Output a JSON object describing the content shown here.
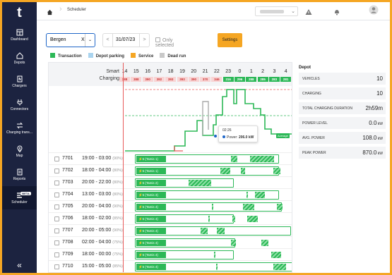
{
  "sidebar": {
    "logo": "t",
    "items": [
      {
        "label": "Dashboard",
        "icon": "dashboard-icon"
      },
      {
        "label": "Depots",
        "icon": "depot-icon"
      },
      {
        "label": "Chargers",
        "icon": "charger-icon"
      },
      {
        "label": "Connectors",
        "icon": "connector-icon"
      },
      {
        "label": "Charging trans...",
        "icon": "transactions-icon"
      },
      {
        "label": "Map",
        "icon": "map-pin-icon"
      },
      {
        "label": "Reports",
        "icon": "reports-icon"
      },
      {
        "label": "Scheduler",
        "icon": "scheduler-icon",
        "badge": "BETA",
        "active": true
      }
    ],
    "collapse_label": "«"
  },
  "topbar": {
    "breadcrumb": "Scheduler"
  },
  "controls": {
    "location_value": "Bergen",
    "clear_label": "X",
    "date": "31/07/23",
    "prev_label": "<",
    "next_label": ">",
    "only_selected_label": "Only selected",
    "settings_label": "Settings"
  },
  "legend": [
    {
      "label": "Transaction",
      "color": "#2cb857"
    },
    {
      "label": "Depot parking",
      "color": "#aad4ef"
    },
    {
      "label": "Service",
      "color": "#f5a623"
    },
    {
      "label": "Dead run",
      "color": "#c9c9c9"
    }
  ],
  "header": {
    "smart_charging_label": "Smart\nCharging",
    "hours": [
      {
        "h": "14",
        "c": "388",
        "tone": "red"
      },
      {
        "h": "15",
        "c": "388",
        "tone": "red"
      },
      {
        "h": "16",
        "c": "390",
        "tone": "red"
      },
      {
        "h": "17",
        "c": "392",
        "tone": "red"
      },
      {
        "h": "18",
        "c": "393",
        "tone": "red"
      },
      {
        "h": "19",
        "c": "393",
        "tone": "red"
      },
      {
        "h": "20",
        "c": "390",
        "tone": "red"
      },
      {
        "h": "21",
        "c": "370",
        "tone": "red"
      },
      {
        "h": "22",
        "c": "346",
        "tone": "red"
      },
      {
        "h": "23",
        "c": "316",
        "tone": "green"
      },
      {
        "h": "0",
        "c": "296",
        "tone": "green"
      },
      {
        "h": "1",
        "c": "288",
        "tone": "green"
      },
      {
        "h": "2",
        "c": "285",
        "tone": "green"
      },
      {
        "h": "3",
        "c": "283",
        "tone": "green"
      },
      {
        "h": "4",
        "c": "281",
        "tone": "green"
      }
    ]
  },
  "chart": {
    "tooltip_time": "02:26",
    "tooltip_label": "Power:",
    "tooltip_value": "206.0 kW",
    "average_label": "Average"
  },
  "rows": [
    {
      "id": "7701",
      "time": "19:00 - 03:00",
      "pct": "(90%)",
      "seg": "5 (Tamis 1)"
    },
    {
      "id": "7702",
      "time": "18:00 - 04:00",
      "pct": "(80%)",
      "seg": "5 (Tamis 1)"
    },
    {
      "id": "7703",
      "time": "20:00 - 22:00",
      "pct": "(80%)",
      "seg": "5 (Tamis 2)"
    },
    {
      "id": "7704",
      "time": "13:00 - 03:00",
      "pct": "(80%)",
      "seg": "5 (Tamis 3)"
    },
    {
      "id": "7705",
      "time": "20:00 - 04:00",
      "pct": "(90%)",
      "seg": "5 (Tamis 4)"
    },
    {
      "id": "7706",
      "time": "18:00 - 02:00",
      "pct": "(85%)",
      "seg": "5 (Tamis 4)"
    },
    {
      "id": "7707",
      "time": "20:00 - 05:00",
      "pct": "(90%)",
      "seg": "5 (Tamis 4)"
    },
    {
      "id": "7708",
      "time": "02:00 - 04:00",
      "pct": "(75%)",
      "seg": "5 (Tamis 4)"
    },
    {
      "id": "7709",
      "time": "18:00 - 00:00",
      "pct": "(75%)",
      "seg": "5 (Tamis 4)"
    },
    {
      "id": "7710",
      "time": "15:00 - 05:00",
      "pct": "(85%)",
      "seg": "5 (Tamis 4)"
    }
  ],
  "depot": {
    "title": "Depot",
    "stats": [
      {
        "label": "VEHICLES",
        "value": "10",
        "unit": ""
      },
      {
        "label": "CHARGING",
        "value": "10",
        "unit": ""
      },
      {
        "label": "TOTAL CHARGING DURATION",
        "value": "2h59m",
        "unit": ""
      },
      {
        "label": "POWER LEVEL",
        "value": "0.0",
        "unit": "kW"
      },
      {
        "label": "AVG. POWER",
        "value": "108.0",
        "unit": "kW"
      },
      {
        "label": "PEAK POWER",
        "value": "870.0",
        "unit": "kW"
      }
    ]
  },
  "colors": {
    "sidebar": "#1c2340",
    "accent": "#f5a623",
    "green": "#2cb857",
    "red": "#e85b5b",
    "blue": "#1f66c8"
  }
}
